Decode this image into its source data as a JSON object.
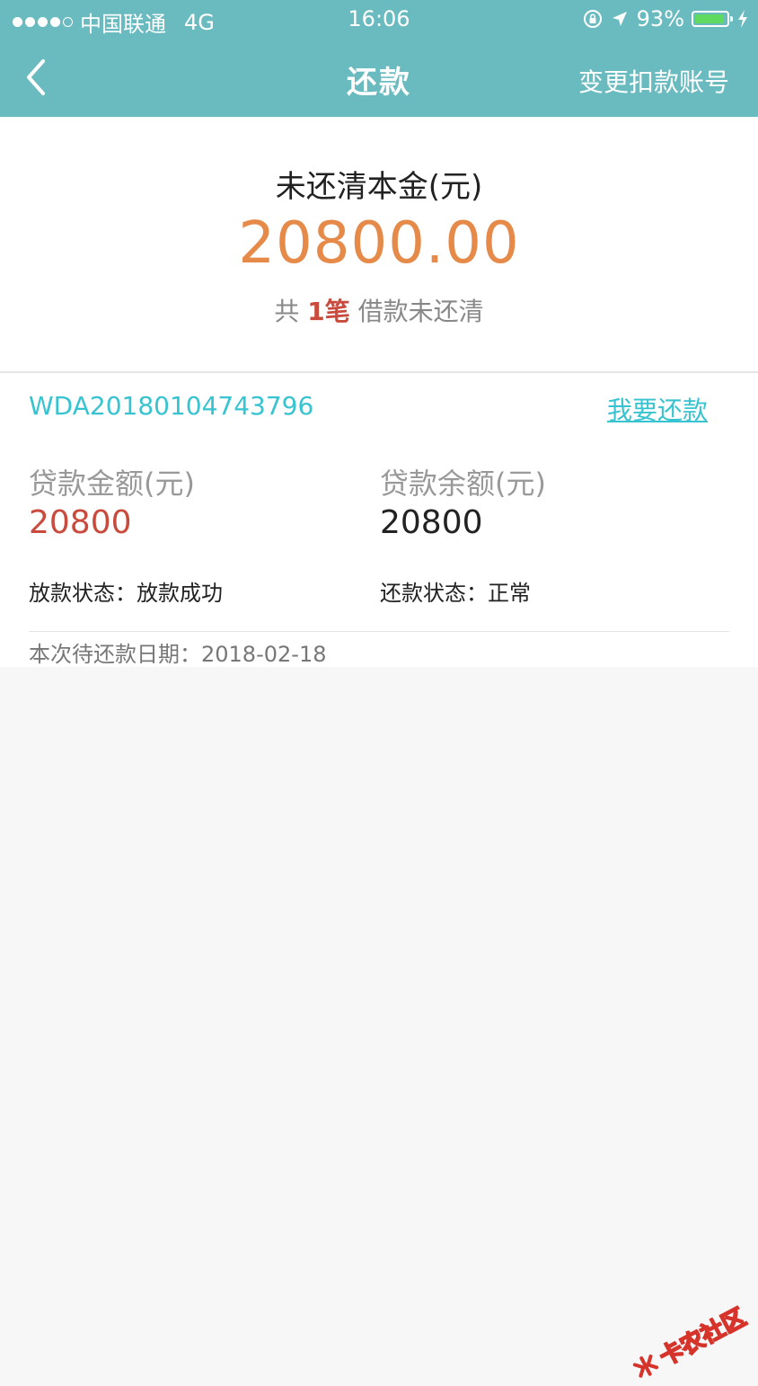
{
  "status_bar": {
    "carrier": "中国联通",
    "network": "4G",
    "time": "16:06",
    "battery": "93%",
    "battery_level": 0.93
  },
  "nav": {
    "title": "还款",
    "right_action": "变更扣款账号"
  },
  "summary": {
    "label": "未还清本金(元)",
    "amount": "20800.00",
    "count_prefix": "共",
    "count_value": "1笔",
    "count_suffix": "借款未还清"
  },
  "loan": {
    "id": "WDA20180104743796",
    "repay_label": "我要还款",
    "amount_label": "贷款金额(元)",
    "amount_value": "20800",
    "balance_label": "贷款余额(元)",
    "balance_value": "20800",
    "disburse_status_label": "放款状态：",
    "disburse_status_value": "放款成功",
    "repay_status_label": "还款状态：",
    "repay_status_value": "正常",
    "due_date_label": "本次待还款日期：",
    "due_date_value": "2018-02-18"
  },
  "watermark": {
    "text": "卡农社区"
  },
  "colors": {
    "header": "#6abbc0",
    "accent_orange": "#e68a4a",
    "accent_red": "#c94b3d",
    "link_cyan": "#38c3d0"
  }
}
